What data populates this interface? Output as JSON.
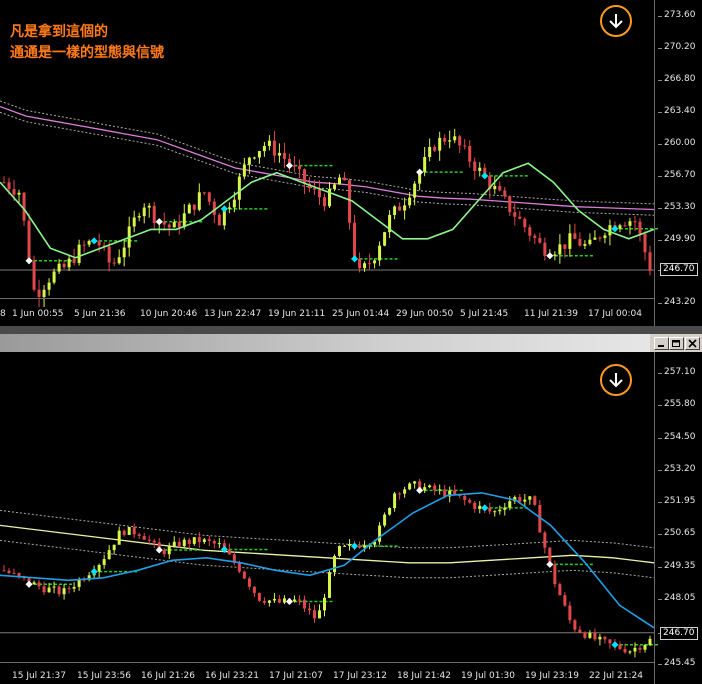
{
  "top_chart": {
    "annotation_lines": [
      "凡是拿到這個的",
      "通通是一樣的型態與信號"
    ],
    "price_labels": [
      "273.60",
      "270.20",
      "266.80",
      "263.40",
      "260.00",
      "256.70",
      "253.30",
      "249.90",
      "246.70",
      "243.20"
    ],
    "price_values": [
      273.6,
      270.2,
      266.8,
      263.4,
      260.0,
      256.7,
      253.3,
      249.9,
      246.7,
      243.2
    ],
    "current_price": "246.70",
    "current_value": 246.7,
    "time_labels": [
      "8",
      "1 Jun 00:55",
      "5 Jun 21:36",
      "10 Jun 20:46",
      "13 Jun 22:47",
      "19 Jun 21:11",
      "25 Jun 01:44",
      "29 Jun 00:50",
      "5 Jul 21:45",
      "11 Jul 21:39",
      "17 Jul 00:04"
    ],
    "close_path": [
      256,
      255,
      244,
      246,
      247,
      249,
      250,
      247,
      250,
      254,
      252,
      251,
      253,
      255,
      252,
      255,
      259,
      260,
      259,
      257,
      255,
      254,
      257,
      246,
      248,
      252,
      254,
      257,
      260,
      261,
      259,
      257,
      255,
      253,
      251,
      249,
      249,
      250,
      249,
      251,
      252,
      252,
      247
    ],
    "ma_green": [
      256,
      253,
      249,
      248,
      249,
      250,
      251,
      251,
      252,
      254,
      256,
      257,
      256,
      255,
      254,
      252,
      250,
      250,
      251,
      254,
      257,
      258,
      256,
      253,
      251,
      250,
      251
    ],
    "ma_purple": [
      264,
      263,
      262.5,
      262,
      261.5,
      261,
      260.5,
      259.5,
      258.5,
      257.5,
      257,
      256.5,
      256,
      255.8,
      255.5,
      255,
      254.5,
      254.3,
      254.2,
      254,
      253.8,
      253.6,
      253.4,
      253.3,
      253.2,
      253.1
    ]
  },
  "bottom_chart": {
    "price_labels": [
      "257.10",
      "255.80",
      "254.50",
      "253.20",
      "251.95",
      "250.65",
      "249.35",
      "248.05",
      "246.70",
      "245.45"
    ],
    "price_values": [
      257.1,
      255.8,
      254.5,
      253.2,
      251.95,
      250.65,
      249.35,
      248.05,
      246.7,
      245.45
    ],
    "current_price": "246.70",
    "current_value": 246.7,
    "time_labels": [
      "15 Jul 21:37",
      "15 Jul 23:56",
      "16 Jul 21:26",
      "16 Jul 23:21",
      "17 Jul 21:07",
      "17 Jul 23:12",
      "18 Jul 21:42",
      "19 Jul 01:30",
      "19 Jul 23:19",
      "22 Jul 21:24"
    ],
    "close_path": [
      249.2,
      248.8,
      248.5,
      248.3,
      248.9,
      249.6,
      250.8,
      250.7,
      249.9,
      250.3,
      250.4,
      250.2,
      249.3,
      248.1,
      247.9,
      248.0,
      247.2,
      250.0,
      250.2,
      250.5,
      252.4,
      252.6,
      252.4,
      252.2,
      251.8,
      251.5,
      252.1,
      252.0,
      249.0,
      247.0,
      246.5,
      246.2,
      246.0,
      246.4
    ],
    "ma_blue": [
      249.0,
      248.9,
      248.8,
      248.9,
      249.2,
      249.6,
      249.7,
      249.5,
      249.2,
      249.0,
      249.4,
      250.5,
      251.5,
      252.2,
      252.3,
      252.0,
      251.0,
      249.5,
      247.8,
      246.9
    ],
    "ma_yellow": [
      251.0,
      250.8,
      250.6,
      250.4,
      250.2,
      250.0,
      249.9,
      249.8,
      249.7,
      249.6,
      249.5,
      249.5,
      249.6,
      249.7,
      249.8,
      249.7,
      249.5
    ]
  },
  "window_buttons": [
    "minimize",
    "restore",
    "close"
  ],
  "colors": {
    "background": "#000000",
    "bull_candle": "#d8f549",
    "bear_candle": "#e1474b",
    "ma_green": "#8af58a",
    "ma_purple": "#d97ed9",
    "ma_blue": "#1e9fe6",
    "ma_yellow": "#e9f3a8",
    "annotation": "#ff7a1a",
    "signal_button": "#ff9a1e"
  }
}
